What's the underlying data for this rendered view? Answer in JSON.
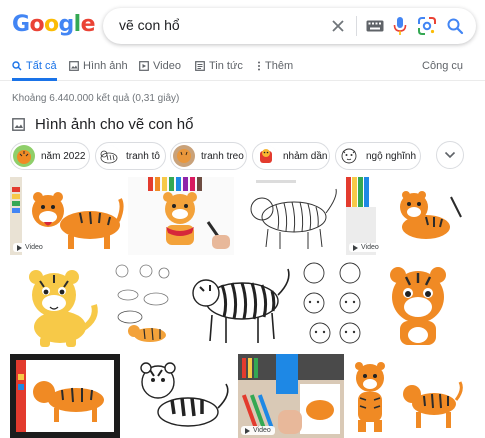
{
  "logo": {
    "letters": [
      "G",
      "o",
      "o",
      "g",
      "l",
      "e"
    ],
    "colors": [
      "#4285f4",
      "#ea4335",
      "#fbbc05",
      "#4285f4",
      "#34a853",
      "#ea4335"
    ]
  },
  "search": {
    "query": "vẽ con hổ"
  },
  "tabs": [
    {
      "label": "Tất cả",
      "icon": "search-icon",
      "active": true
    },
    {
      "label": "Hình ảnh",
      "icon": "image-icon"
    },
    {
      "label": "Video",
      "icon": "video-icon"
    },
    {
      "label": "Tin tức",
      "icon": "news-icon"
    },
    {
      "label": "Thêm",
      "icon": "more-vert-icon"
    }
  ],
  "tools_label": "Công cụ",
  "result_stats": "Khoảng 6.440.000 kết quả (0,31 giây)",
  "images_heading": "Hình ảnh cho vẽ con hổ",
  "chips": [
    {
      "label": "năm 2022"
    },
    {
      "label": "tranh tô"
    },
    {
      "label": "tranh treo"
    },
    {
      "label": "nhảm dần"
    },
    {
      "label": "ngộ nghĩnh"
    }
  ],
  "video_badge": "Video",
  "colors": {
    "accent": "#1a73e8",
    "tiger_orange": "#f08a24",
    "stripe": "#2b2b2b",
    "tiger_yellow": "#f7c948"
  }
}
